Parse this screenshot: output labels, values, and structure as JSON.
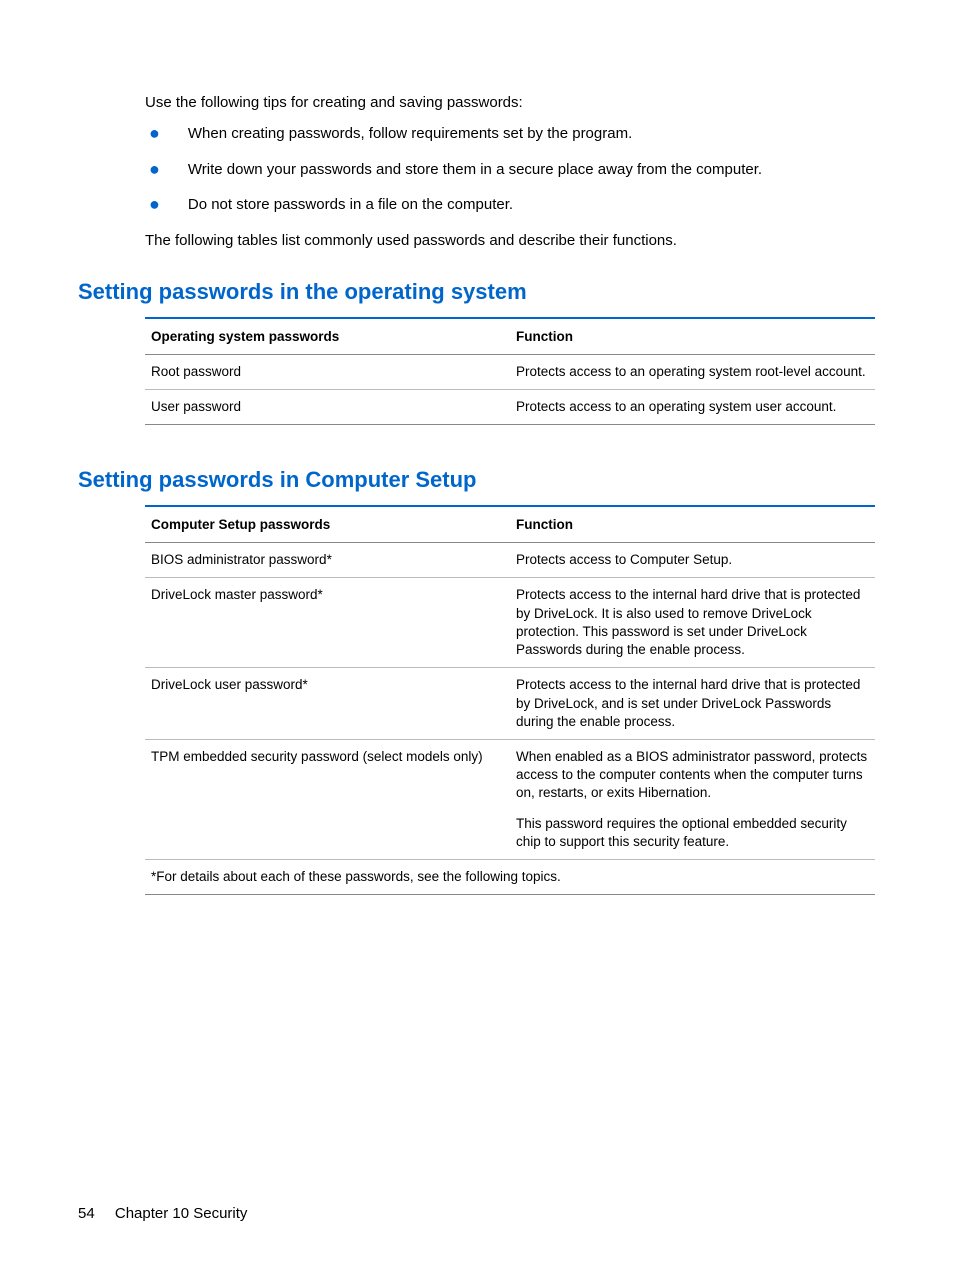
{
  "intro": {
    "line1": "Use the following tips for creating and saving passwords:",
    "bullets": [
      "When creating passwords, follow requirements set by the program.",
      "Write down your passwords and store them in a secure place away from the computer.",
      "Do not store passwords in a file on the computer."
    ],
    "line2": "The following tables list commonly used passwords and describe their functions."
  },
  "section1": {
    "heading": "Setting passwords in the operating system",
    "header_col1": "Operating system passwords",
    "header_col2": "Function",
    "rows": [
      {
        "c1": "Root password",
        "c2": "Protects access to an operating system root-level account."
      },
      {
        "c1": "User password",
        "c2": "Protects access to an operating system user account."
      }
    ]
  },
  "section2": {
    "heading": "Setting passwords in Computer Setup",
    "header_col1": "Computer Setup passwords",
    "header_col2": "Function",
    "rows": [
      {
        "c1": "BIOS administrator password*",
        "c2": "Protects access to Computer Setup."
      },
      {
        "c1": "DriveLock master password*",
        "c2": "Protects access to the internal hard drive that is protected by DriveLock. It is also used to remove DriveLock protection. This password is set under DriveLock Passwords during the enable process."
      },
      {
        "c1": "DriveLock user password*",
        "c2": "Protects access to the internal hard drive that is protected by DriveLock, and is set under DriveLock Passwords during the enable process."
      },
      {
        "c1": "TPM embedded security password (select models only)",
        "c2a": "When enabled as a BIOS administrator password, protects access to the computer contents when the computer turns on, restarts, or exits Hibernation.",
        "c2b": "This password requires the optional embedded security chip to support this security feature."
      }
    ],
    "footnote": "*For details about each of these passwords, see the following topics."
  },
  "footer": {
    "page": "54",
    "chapter": "Chapter 10   Security"
  }
}
